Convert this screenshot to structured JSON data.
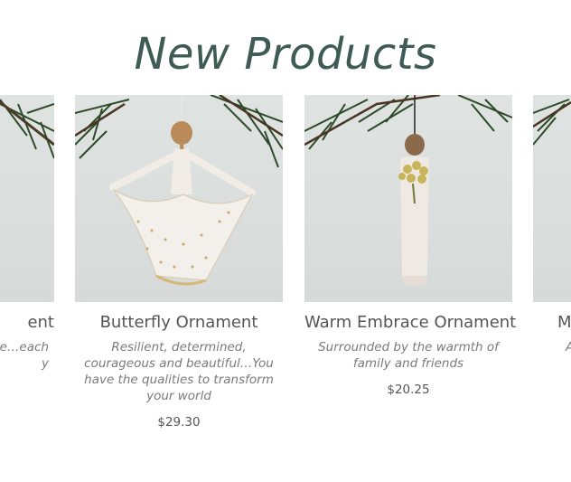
{
  "section": {
    "title": "New Products"
  },
  "products": [
    {
      "name": "ent",
      "desc": "re…each\ny",
      "price": ""
    },
    {
      "name": "Butterfly Ornament",
      "desc": "Resilient, determined, courageous and beautiful…You have the qualities to transform your world",
      "price": "$29.30"
    },
    {
      "name": "Warm Embrace Ornament",
      "desc": "Surrounded by the warmth of family and friends",
      "price": "$20.25"
    },
    {
      "name": "M",
      "desc": "A",
      "price": ""
    }
  ]
}
